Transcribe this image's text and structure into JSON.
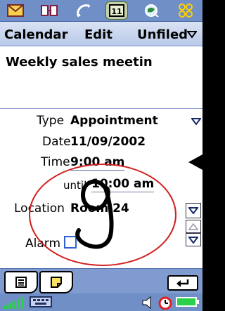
{
  "appbar": {
    "icons": [
      "mail-icon",
      "contacts-icon",
      "phone-icon",
      "calendar-icon",
      "web-icon",
      "apps-icon"
    ],
    "active": "calendar-icon",
    "active_label": "11"
  },
  "menubar": {
    "calendar_label": "Calendar",
    "edit_label": "Edit",
    "unfiled_label": "Unfiled"
  },
  "event": {
    "subject": "Weekly sales meetin",
    "type_label": "Type",
    "type_value": "Appointment",
    "date_label": "Date",
    "date_value": "11/09/2002",
    "time_label": "Time",
    "time_value": "9:00 am",
    "until_label": "until",
    "until_value": "10:00 am",
    "location_label": "Location",
    "location_value": "Room 24",
    "alarm_label": "Alarm",
    "alarm_checked": false
  },
  "colors": {
    "bar_blue": "#6f8fc6",
    "menu_bg": "#c9d6ef",
    "scribble_red": "#d02020"
  }
}
